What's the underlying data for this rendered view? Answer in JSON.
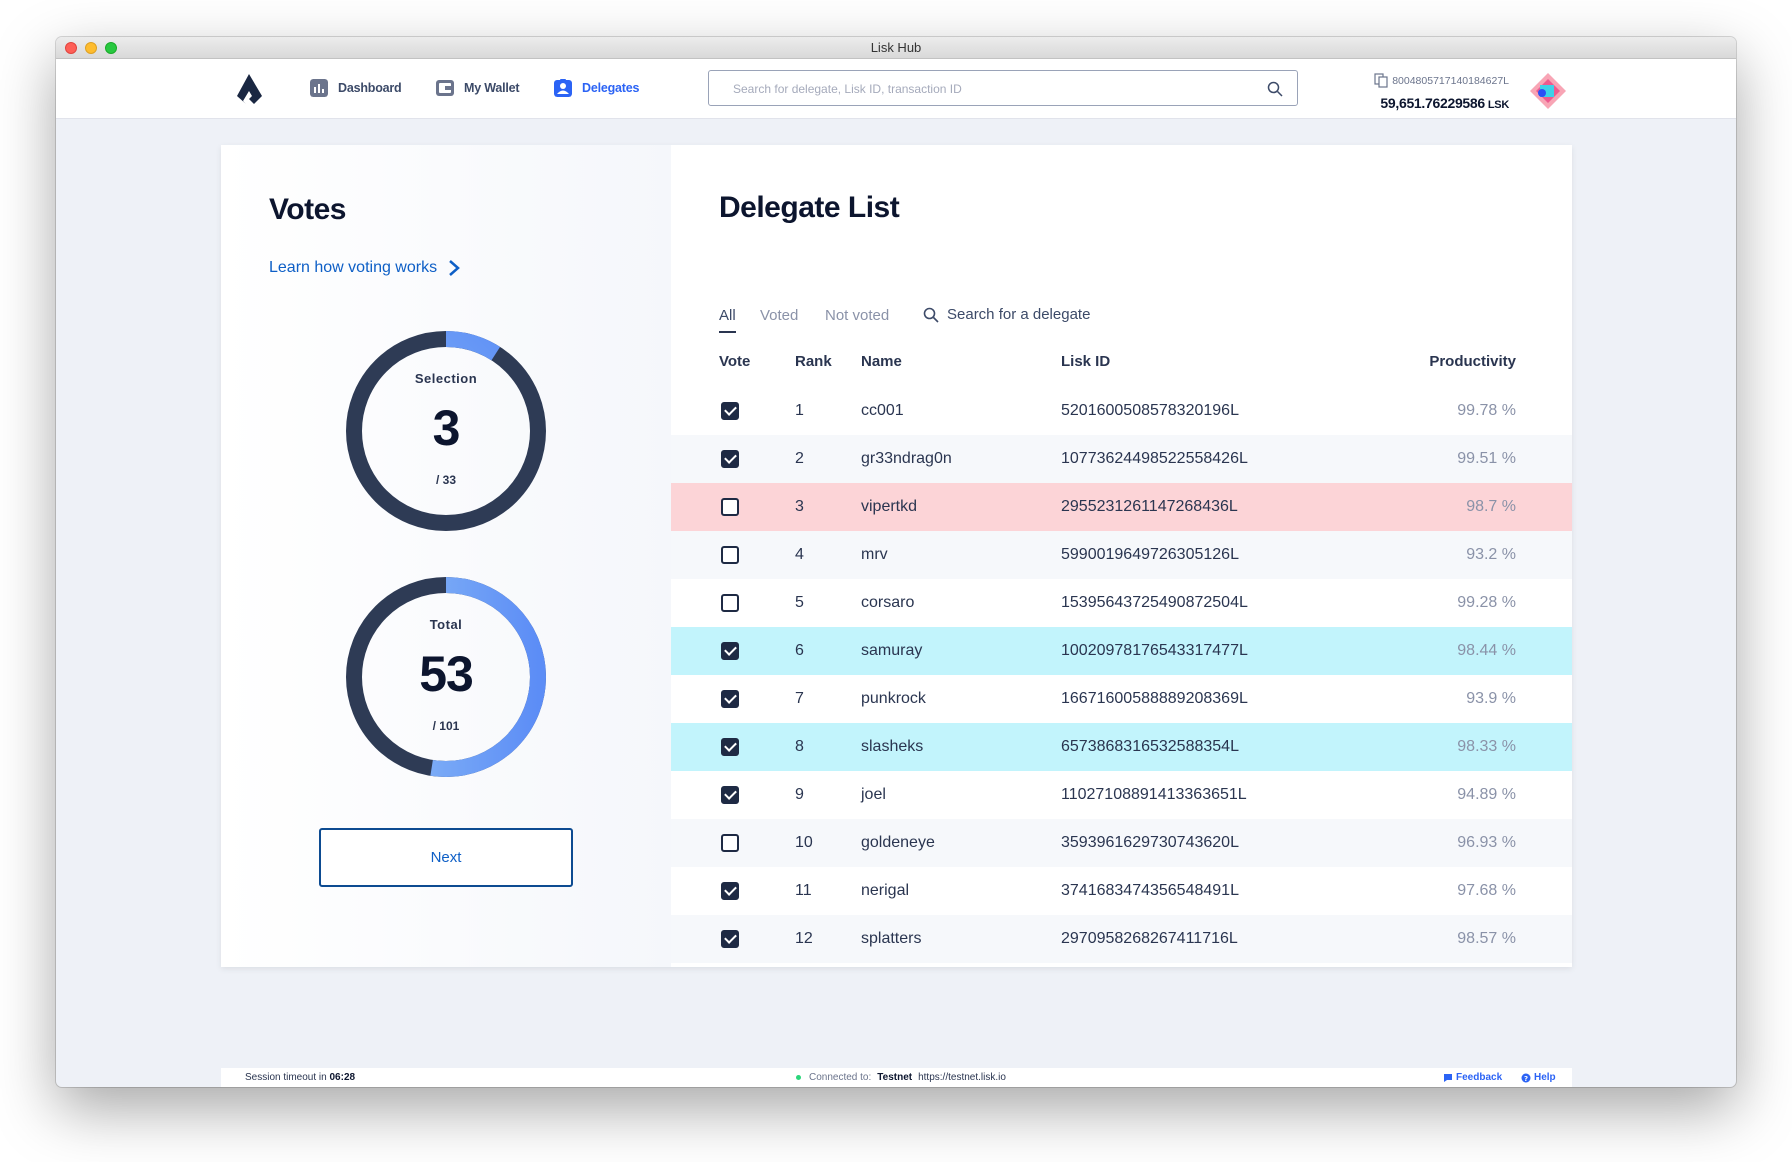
{
  "window": {
    "title": "Lisk Hub"
  },
  "nav": {
    "dashboard": "Dashboard",
    "wallet": "My Wallet",
    "delegates": "Delegates"
  },
  "search": {
    "placeholder": "Search for delegate, Lisk ID, transaction ID"
  },
  "account": {
    "address": "8004805717140184627L",
    "balance": "59,651.76229586",
    "unit": "LSK"
  },
  "votes": {
    "title": "Votes",
    "learn_link": "Learn how voting works",
    "selection": {
      "label": "Selection",
      "value": "3",
      "max": "/ 33",
      "fraction": 0.0909
    },
    "total": {
      "label": "Total",
      "value": "53",
      "max": "/ 101",
      "fraction": 0.5248
    },
    "next_button": "Next"
  },
  "delegate_list": {
    "title": "Delegate List",
    "tabs": [
      "All",
      "Voted",
      "Not voted"
    ],
    "active_tab": "All",
    "search_placeholder": "Search for a delegate",
    "columns": {
      "vote": "Vote",
      "rank": "Rank",
      "name": "Name",
      "lisk_id": "Lisk ID",
      "productivity": "Productivity"
    },
    "rows": [
      {
        "voted": true,
        "rank": "1",
        "name": "cc001",
        "lisk_id": "5201600508578320196L",
        "productivity": "99.78 %",
        "highlight": ""
      },
      {
        "voted": true,
        "rank": "2",
        "name": "gr33ndrag0n",
        "lisk_id": "10773624498522558426L",
        "productivity": "99.51 %",
        "highlight": ""
      },
      {
        "voted": false,
        "rank": "3",
        "name": "vipertkd",
        "lisk_id": "2955231261147268436L",
        "productivity": "98.7 %",
        "highlight": "red"
      },
      {
        "voted": false,
        "rank": "4",
        "name": "mrv",
        "lisk_id": "5990019649726305126L",
        "productivity": "93.2 %",
        "highlight": ""
      },
      {
        "voted": false,
        "rank": "5",
        "name": "corsaro",
        "lisk_id": "15395643725490872504L",
        "productivity": "99.28 %",
        "highlight": ""
      },
      {
        "voted": true,
        "rank": "6",
        "name": "samuray",
        "lisk_id": "10020978176543317477L",
        "productivity": "98.44 %",
        "highlight": "cyan"
      },
      {
        "voted": true,
        "rank": "7",
        "name": "punkrock",
        "lisk_id": "16671600588889208369L",
        "productivity": "93.9 %",
        "highlight": ""
      },
      {
        "voted": true,
        "rank": "8",
        "name": "slasheks",
        "lisk_id": "6573868316532588354L",
        "productivity": "98.33 %",
        "highlight": "cyan"
      },
      {
        "voted": true,
        "rank": "9",
        "name": "joel",
        "lisk_id": "11027108891413363651L",
        "productivity": "94.89 %",
        "highlight": ""
      },
      {
        "voted": false,
        "rank": "10",
        "name": "goldeneye",
        "lisk_id": "3593961629730743620L",
        "productivity": "96.93 %",
        "highlight": ""
      },
      {
        "voted": true,
        "rank": "11",
        "name": "nerigal",
        "lisk_id": "3741683474356548491L",
        "productivity": "97.68 %",
        "highlight": ""
      },
      {
        "voted": true,
        "rank": "12",
        "name": "splatters",
        "lisk_id": "2970958268267411716L",
        "productivity": "98.57 %",
        "highlight": ""
      }
    ]
  },
  "footer": {
    "session_prefix": "Session timeout in",
    "session_time": "06:28",
    "connected_to": "Connected to:",
    "network": "Testnet",
    "url": "https://testnet.lisk.io",
    "feedback": "Feedback",
    "help": "Help"
  },
  "colors": {
    "accent": "#2b63f5",
    "ring_dark": "#2e3b55",
    "ring_gradient_start": "#90c0f7",
    "ring_gradient_end": "#5c8df6",
    "highlight_red": "#fcd4d7",
    "highlight_cyan": "#c2f4fc"
  }
}
